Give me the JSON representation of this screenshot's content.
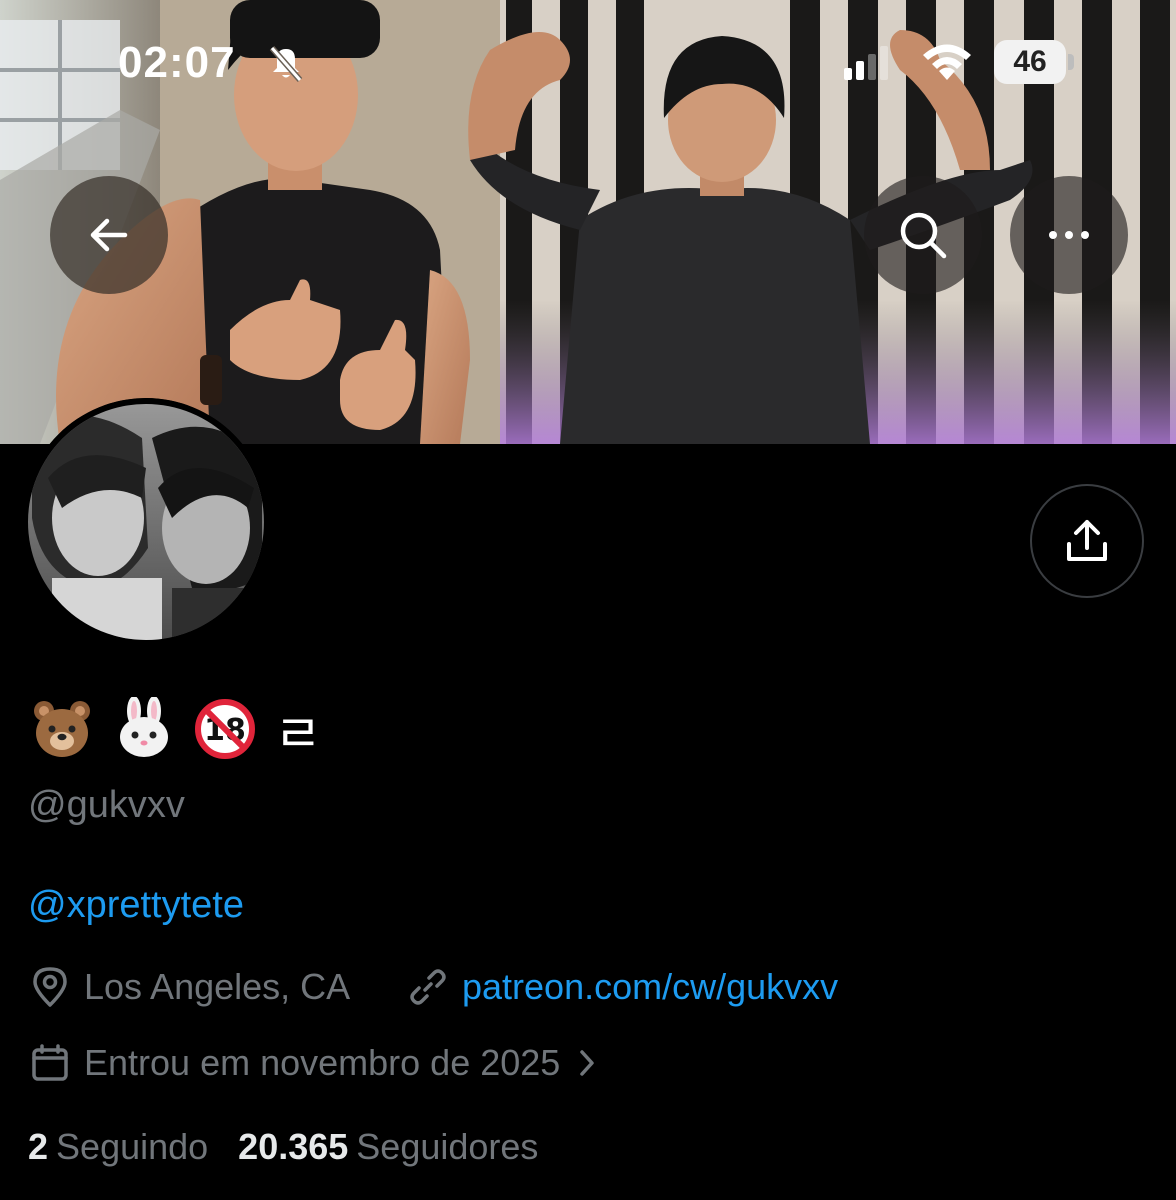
{
  "status_bar": {
    "time": "02:07",
    "battery": "46"
  },
  "header": {
    "back_icon": "arrow-left-icon",
    "search_icon": "search-icon",
    "more_icon": "more-horizontal-icon",
    "share_icon": "share-upload-icon"
  },
  "profile": {
    "display_name_emojis": [
      "🐻",
      "🐰",
      "🔞"
    ],
    "display_name_suffix": "ㄹ",
    "handle": "@gukvxv",
    "bio": "@xprettytete",
    "location": "Los Angeles, CA",
    "link": "patreon.com/cw/gukvxv",
    "joined": "Entrou em novembro de 2025"
  },
  "stats": {
    "following_count": "2",
    "following_label": "Seguindo",
    "followers_count": "20.365",
    "followers_label": "Seguidores"
  },
  "colors": {
    "background": "#000000",
    "link_blue": "#1d9bf0",
    "muted_text": "#71767b",
    "primary_text": "#e7e9ea"
  }
}
